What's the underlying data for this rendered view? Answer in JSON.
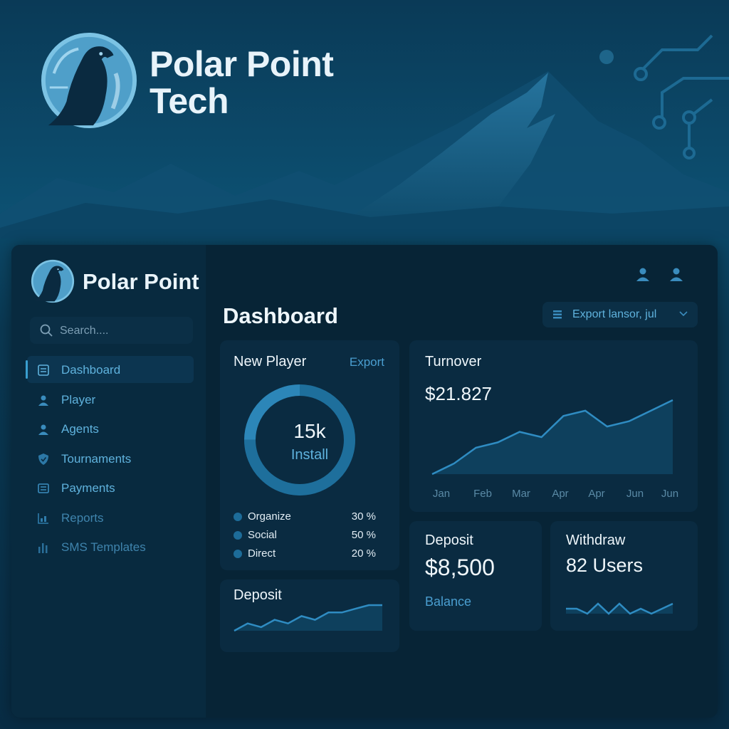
{
  "hero": {
    "title_line1": "Polar Point",
    "title_line2": "Tech"
  },
  "sidebar": {
    "brand": "Polar Point",
    "search_placeholder": "Search....",
    "items": [
      {
        "label": "Dashboard",
        "icon": "dashboard-icon",
        "active": true
      },
      {
        "label": "Player",
        "icon": "user-icon"
      },
      {
        "label": "Agents",
        "icon": "user-icon"
      },
      {
        "label": "Tournaments",
        "icon": "shield-icon"
      },
      {
        "label": "Payments",
        "icon": "document-icon"
      },
      {
        "label": "Reports",
        "icon": "report-icon"
      },
      {
        "label": "SMS Templates",
        "icon": "bar-chart-icon"
      }
    ]
  },
  "header": {
    "title": "Dashboard",
    "export_label": "Export lansor, jul"
  },
  "new_player": {
    "title": "New Player",
    "export": "Export",
    "center_value": "15k",
    "center_label": "Install",
    "legend": [
      {
        "name": "Organize",
        "pct": "30 %"
      },
      {
        "name": "Social",
        "pct": "50 %"
      },
      {
        "name": "Direct",
        "pct": "20 %"
      }
    ]
  },
  "turnover": {
    "title": "Turnover",
    "value": "$21.827"
  },
  "deposit_small": {
    "title": "Deposit"
  },
  "deposit": {
    "title": "Deposit",
    "value": "$8,500",
    "sub": "Balance"
  },
  "withdraw": {
    "title": "Withdraw",
    "value": "82 Users"
  },
  "colors": {
    "accent": "#3a9fd0",
    "label": "#5fb2dd",
    "card": "#0a2b41",
    "bg": "#072436"
  },
  "chart_data": [
    {
      "type": "area",
      "title": "Turnover",
      "categories": [
        "Jan",
        "Feb",
        "Mar",
        "Apr",
        "Apr",
        "Jun",
        "Jun"
      ],
      "x": [
        0,
        1,
        2,
        3,
        4,
        5,
        6,
        7,
        8,
        9,
        10,
        11
      ],
      "values": [
        0,
        2,
        5,
        6,
        8,
        7,
        11,
        12,
        9,
        10,
        12,
        14
      ],
      "xlabel": "",
      "ylabel": "",
      "grid": false
    },
    {
      "type": "area",
      "title": "Deposit",
      "values": [
        3,
        5,
        4,
        6,
        5,
        7,
        6,
        8,
        8,
        9,
        10,
        10
      ],
      "grid": false
    },
    {
      "type": "line",
      "title": "Withdraw",
      "values": [
        5,
        5,
        4,
        6,
        4,
        6,
        4,
        5,
        4,
        5,
        6
      ],
      "grid": false
    }
  ]
}
